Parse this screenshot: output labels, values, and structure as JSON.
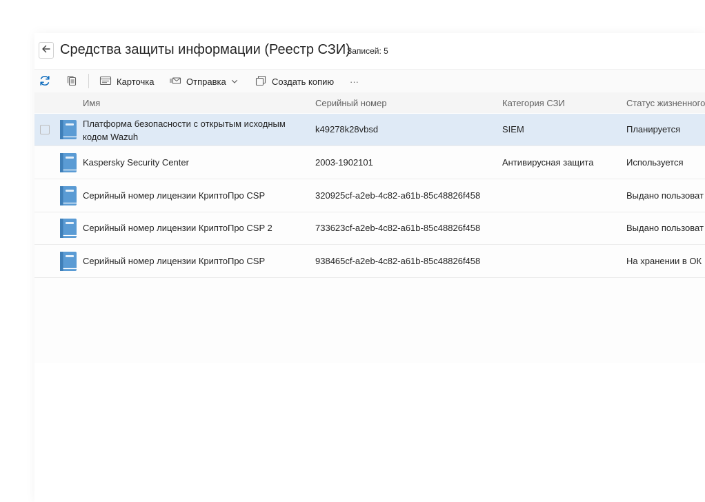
{
  "header": {
    "title": "Средства защиты информации (Реестр СЗИ)",
    "count_label": "Записей: 5"
  },
  "toolbar": {
    "card_label": "Карточка",
    "send_label": "Отправка",
    "copy_label": "Создать копию",
    "more_label": "···"
  },
  "table": {
    "columns": [
      "Имя",
      "Серийный номер",
      "Категория СЗИ",
      "Статус жизненного"
    ],
    "rows": [
      {
        "name": "Платформа безопасности с открытым исходным кодом Wazuh",
        "serial": "k49278k28vbsd",
        "category": "SIEM",
        "status": "Планируется",
        "selected": true
      },
      {
        "name": "Kaspersky Security Center",
        "serial": "2003-1902101",
        "category": "Антивирусная защита",
        "status": "Используется",
        "selected": false
      },
      {
        "name": "Серийный номер лицензии КриптоПро CSP",
        "serial": "320925cf-a2eb-4c82-a61b-85c48826f458",
        "category": "",
        "status": "Выдано пользоват",
        "selected": false
      },
      {
        "name": "Серийный номер лицензии КриптоПро CSP 2",
        "serial": "733623cf-a2eb-4c82-a61b-85c48826f458",
        "category": "",
        "status": "Выдано пользоват",
        "selected": false
      },
      {
        "name": "Серийный номер лицензии КриптоПро CSP",
        "serial": "938465cf-a2eb-4c82-a61b-85c48826f458",
        "category": "",
        "status": "На хранении в ОК",
        "selected": false
      }
    ]
  },
  "icons": {
    "back": "arrow-left-icon",
    "refresh": "refresh-icon",
    "copy": "copy-icon",
    "card": "card-icon",
    "send": "send-icon",
    "duplicate": "duplicate-icon",
    "row": "book-icon"
  },
  "colors": {
    "accent": "#0f6cbd",
    "selected_row": "#dfeaf6",
    "book_icon": "#5a9bd4"
  }
}
